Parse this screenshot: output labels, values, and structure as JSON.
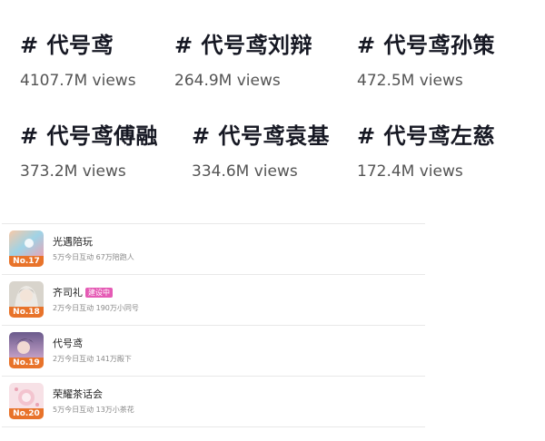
{
  "tags": [
    {
      "title": "# 代号鸢",
      "views": "4107.7M views"
    },
    {
      "title": "# 代号鸢刘辩",
      "views": "264.9M views"
    },
    {
      "title": "# 代号鸢孙策",
      "views": "472.5M views"
    },
    {
      "title": "# 代号鸢傅融",
      "views": "373.2M views"
    },
    {
      "title": "# 代号鸢袁基",
      "views": "334.6M views"
    },
    {
      "title": "# 代号鸢左慈",
      "views": "172.4M views"
    }
  ],
  "list": [
    {
      "rank": "No.17",
      "name": "光遇陪玩",
      "badge": "",
      "sub": "5万今日互动 67万陪跑人"
    },
    {
      "rank": "No.18",
      "name": "齐司礼",
      "badge": "建设中",
      "sub": "2万今日互动 190万小同号"
    },
    {
      "rank": "No.19",
      "name": "代号鸢",
      "badge": "",
      "sub": "2万今日互动 141万殿下"
    },
    {
      "rank": "No.20",
      "name": "荣耀茶话会",
      "badge": "",
      "sub": "5万今日互动 13万小茶花"
    }
  ]
}
